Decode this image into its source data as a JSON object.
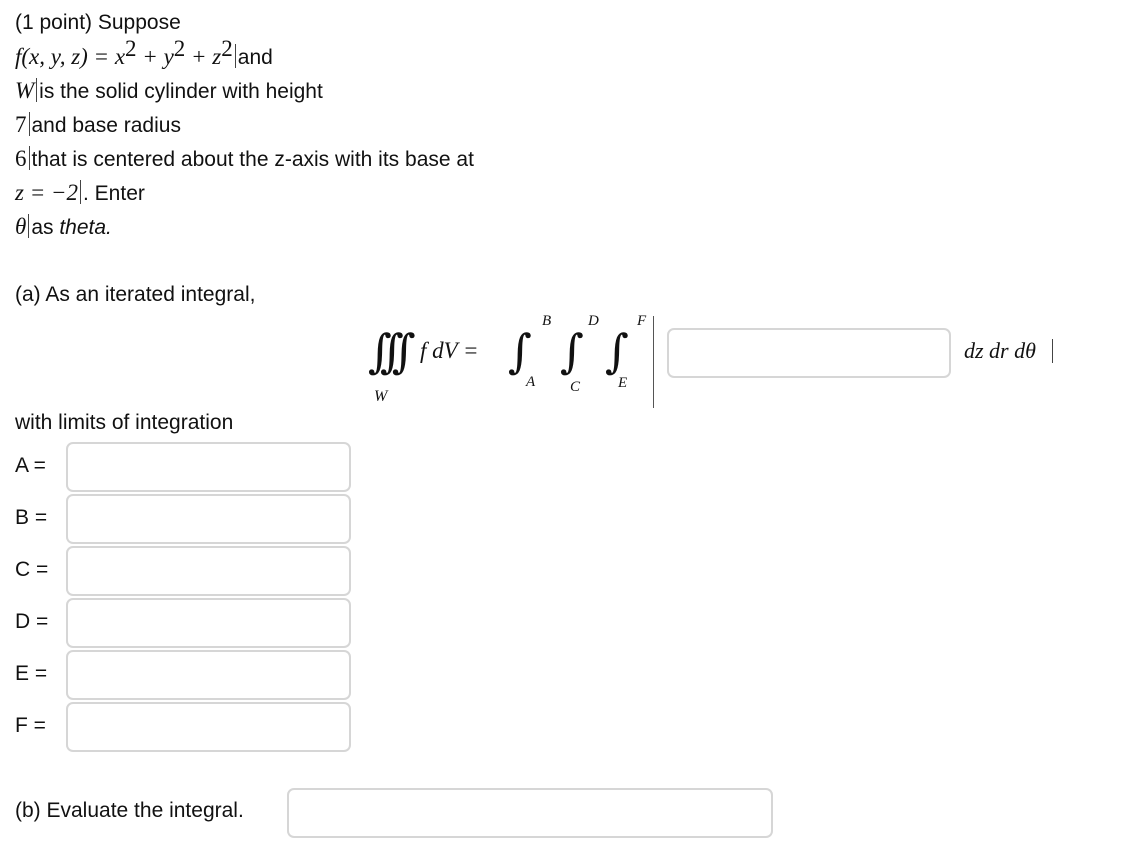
{
  "problem": {
    "intro": "(1 point) Suppose",
    "func_lhs": "f(x, y, z) = x",
    "plus_y": " + y",
    "plus_z": " + z",
    "sup2": "2",
    "and": "and",
    "W": "W",
    "cyl_text": "is the solid cylinder with height",
    "height": "7",
    "base_text": "and base radius",
    "radius": "6",
    "centered_text": "that is centered about the z-axis with its base at",
    "z_eq": "z = −2",
    "enter_text": ". Enter",
    "theta": "θ",
    "as_text": "as",
    "theta_word": "theta."
  },
  "part_a": {
    "label": "(a) As an iterated integral,",
    "iint_sub": "W",
    "f_dV": "f dV =",
    "limits": {
      "B": "B",
      "D": "D",
      "F": "F",
      "A": "A",
      "C": "C",
      "E": "E"
    },
    "differentials": "dz dr dθ",
    "integrand_value": "",
    "limits_label": "with limits of integration",
    "fields": [
      {
        "label": "A =",
        "value": ""
      },
      {
        "label": "B =",
        "value": ""
      },
      {
        "label": "C =",
        "value": ""
      },
      {
        "label": "D =",
        "value": ""
      },
      {
        "label": "E =",
        "value": ""
      },
      {
        "label": "F =",
        "value": ""
      }
    ]
  },
  "part_b": {
    "label": "(b) Evaluate the integral.",
    "value": ""
  }
}
